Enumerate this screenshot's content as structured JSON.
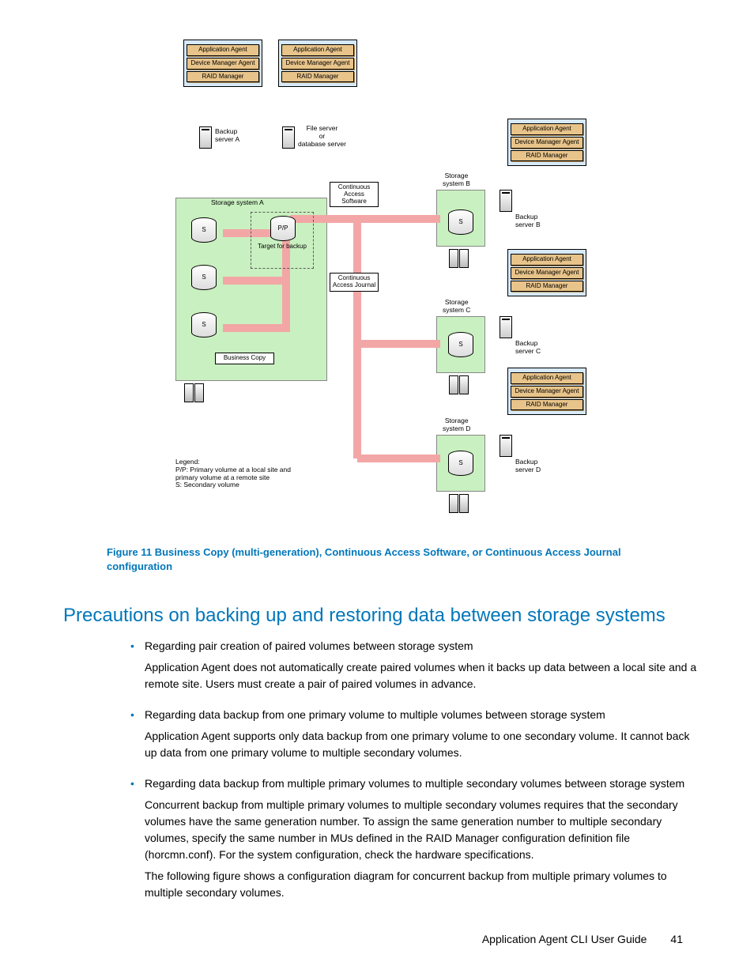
{
  "diagram": {
    "stack_left_1": {
      "p1": "Application Agent",
      "p2": "Device Manager\nAgent",
      "p3": "RAID Manager"
    },
    "stack_left_2": {
      "p1": "Application Agent",
      "p2": "Device Manager\nAgent",
      "p3": "RAID Manager"
    },
    "stack_right_b": {
      "p1": "Application Agent",
      "p2": "Device Manager\nAgent",
      "p3": "RAID Manager"
    },
    "stack_right_c": {
      "p1": "Application Agent",
      "p2": "Device Manager\nAgent",
      "p3": "RAID Manager"
    },
    "stack_right_d": {
      "p1": "Application Agent",
      "p2": "Device Manager\nAgent",
      "p3": "RAID Manager"
    },
    "backup_server_a": "Backup\nserver A",
    "file_server": "File server\nor\ndatabase server",
    "storage_system_a": "Storage system A",
    "storage_system_b": "Storage\nsystem B",
    "storage_system_c": "Storage\nsystem C",
    "storage_system_d": "Storage\nsystem D",
    "backup_server_b": "Backup\nserver B",
    "backup_server_c": "Backup\nserver C",
    "backup_server_d": "Backup\nserver D",
    "cont_access_sw": "Continuous\nAccess\nSoftware",
    "cont_access_jrnl": "Continuous\nAccess\nJournal",
    "business_copy": "Business Copy",
    "target_for_backup": "Target for\nbackup",
    "pp": "P/P",
    "s": "S",
    "legend": "Legend:\nP/P: Primary volume at a local site and\nprimary volume at a remote site\nS: Secondary volume"
  },
  "caption": "Figure 11 Business Copy (multi-generation), Continuous Access Software, or Continuous Access Journal configuration",
  "heading": "Precautions on backing up and restoring data between storage systems",
  "bullets": [
    {
      "title": "Regarding pair creation of paired volumes between storage system",
      "body": "Application Agent does not automatically create paired volumes when it backs up data between a local site and a remote site. Users must create a pair of paired volumes in advance."
    },
    {
      "title": "Regarding data backup from one primary volume to multiple volumes between storage system",
      "body": "Application Agent supports only data backup from one primary volume to one secondary volume. It cannot back up data from one primary volume to multiple secondary volumes."
    },
    {
      "title": "Regarding data backup from multiple primary volumes to multiple secondary volumes between storage system",
      "body": "Concurrent backup from multiple primary volumes to multiple secondary volumes requires that the secondary volumes have the same generation number. To assign the same generation number to multiple secondary volumes, specify the same number in MUs defined in the RAID Manager configuration definition file (horcmn.conf). For the system configuration, check the hardware specifications.",
      "body2": "The following figure shows a configuration diagram for concurrent backup from multiple primary volumes to multiple secondary volumes."
    }
  ],
  "footer": {
    "title": "Application Agent CLI User Guide",
    "page": "41"
  }
}
